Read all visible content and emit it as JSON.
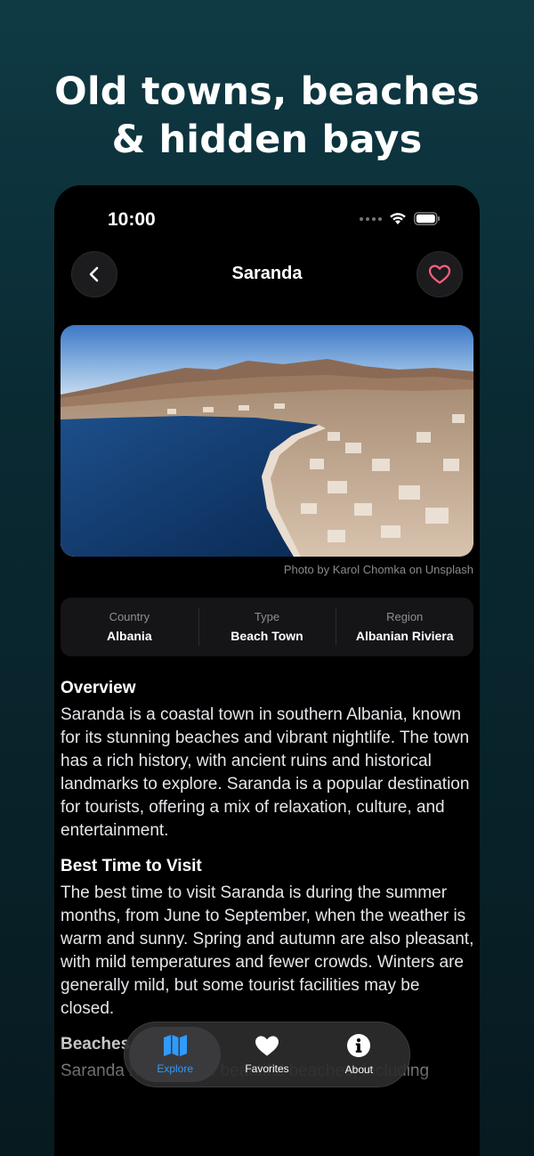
{
  "headline": {
    "line1": "Old towns, beaches",
    "line2": "& hidden bays"
  },
  "status_bar": {
    "time": "10:00"
  },
  "nav": {
    "title": "Saranda"
  },
  "photo": {
    "credit": "Photo by Karol Chomka on Unsplash"
  },
  "info": [
    {
      "label": "Country",
      "value": "Albania"
    },
    {
      "label": "Type",
      "value": "Beach Town"
    },
    {
      "label": "Region",
      "value": "Albanian Riviera"
    }
  ],
  "sections": {
    "overview": {
      "title": "Overview",
      "body": "Saranda is a coastal town in southern Albania, known for its stunning beaches and vibrant nightlife. The town has a rich history, with ancient ruins and historical landmarks to explore. Saranda is a popular destination for tourists, offering a mix of relaxation, culture, and entertainment."
    },
    "best_time": {
      "title": "Best Time to Visit",
      "body": "The best time to visit Saranda is during the summer months, from June to September, when the weather is warm and sunny. Spring and autumn are also pleasant, with mild temperatures and fewer crowds. Winters are generally mild, but some tourist facilities may be closed."
    },
    "beaches": {
      "title": "Beaches",
      "body": "Saranda has several beautiful beaches, including"
    }
  },
  "tabbar": [
    {
      "label": "Explore",
      "icon": "map-icon",
      "active": true
    },
    {
      "label": "Favorites",
      "icon": "heart-icon",
      "active": false
    },
    {
      "label": "About",
      "icon": "info-icon",
      "active": false
    }
  ],
  "colors": {
    "accent": "#2f9bff",
    "heart": "#ff5f7e",
    "background_top": "#0f3a44",
    "background_bottom": "#071a20"
  }
}
